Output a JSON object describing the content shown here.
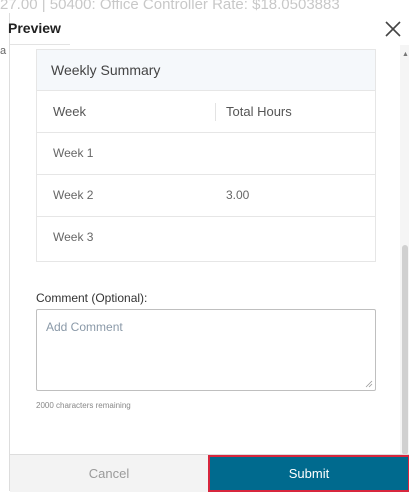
{
  "background": {
    "text": "27.00 | 50400: Office Controller Rate: $18.0503883"
  },
  "dialog": {
    "title": "Preview",
    "close_icon": "close-icon"
  },
  "summary": {
    "heading": "Weekly Summary",
    "columns": [
      "Week",
      "Total Hours"
    ],
    "rows": [
      {
        "week": "Week 1",
        "hours": ""
      },
      {
        "week": "Week 2",
        "hours": "3.00"
      },
      {
        "week": "Week 3",
        "hours": ""
      }
    ]
  },
  "comment": {
    "label": "Comment (Optional):",
    "placeholder": "Add Comment",
    "remaining": "2000 characters remaining"
  },
  "footer": {
    "cancel_label": "Cancel",
    "submit_label": "Submit"
  },
  "colors": {
    "submit_bg": "#006a8e",
    "highlight_border": "#d7263d"
  }
}
